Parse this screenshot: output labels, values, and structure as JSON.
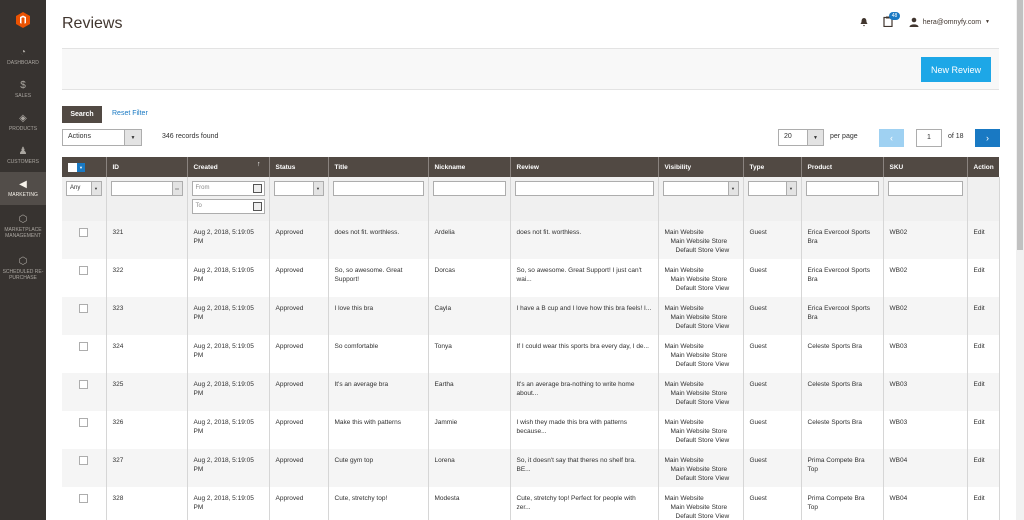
{
  "sidebar": {
    "items": [
      {
        "label": "DASHBOARD",
        "icon": "gauge-icon",
        "glyph": "◔"
      },
      {
        "label": "SALES",
        "icon": "dollar-icon",
        "glyph": "$"
      },
      {
        "label": "PRODUCTS",
        "icon": "cube-icon",
        "glyph": "◈"
      },
      {
        "label": "CUSTOMERS",
        "icon": "person-icon",
        "glyph": "♟"
      },
      {
        "label": "MARKETING",
        "icon": "megaphone-icon",
        "glyph": "◀"
      },
      {
        "label": "MARKETPLACE MANAGEMENT",
        "icon": "hexagon-icon",
        "glyph": "⬡"
      },
      {
        "label": "SCHEDULED RE-PURCHASE",
        "icon": "hexagon-icon",
        "glyph": "⬡"
      }
    ],
    "active_index": 4
  },
  "header": {
    "title": "Reviews",
    "notification_count": "48",
    "user_email": "hera@omnyfy.com"
  },
  "toolbar": {
    "new_button": "New Review",
    "search_button": "Search",
    "reset_filter": "Reset Filter",
    "actions_label": "Actions",
    "records_found": "346 records found",
    "per_page_value": "20",
    "per_page_label": "per page",
    "current_page": "1",
    "page_of": "of 18"
  },
  "columns": [
    "ID",
    "Created",
    "Status",
    "Title",
    "Nickname",
    "Review",
    "Visibility",
    "Type",
    "Product",
    "SKU",
    "Action"
  ],
  "filters": {
    "any_label": "Any",
    "from_placeholder": "From",
    "to_placeholder": "To"
  },
  "rows": [
    {
      "id": "321",
      "created": "Aug 2, 2018, 5:19:05 PM",
      "status": "Approved",
      "title": "does not fit. worthless.",
      "nickname": "Ardelia",
      "review": "does not fit. worthless.",
      "vis1": "Main Website",
      "vis2": "Main Website Store",
      "vis3": "Default Store View",
      "type": "Guest",
      "product": "Erica Evercool Sports Bra",
      "sku": "WB02",
      "action": "Edit"
    },
    {
      "id": "322",
      "created": "Aug 2, 2018, 5:19:05 PM",
      "status": "Approved",
      "title": "So, so awesome. Great Support!",
      "nickname": "Dorcas",
      "review": "So, so awesome. Great Support! I just can't wai...",
      "vis1": "Main Website",
      "vis2": "Main Website Store",
      "vis3": "Default Store View",
      "type": "Guest",
      "product": "Erica Evercool Sports Bra",
      "sku": "WB02",
      "action": "Edit"
    },
    {
      "id": "323",
      "created": "Aug 2, 2018, 5:19:05 PM",
      "status": "Approved",
      "title": "I love this bra",
      "nickname": "Cayla",
      "review": "I have a B cup and I love how this bra feels! I...",
      "vis1": "Main Website",
      "vis2": "Main Website Store",
      "vis3": "Default Store View",
      "type": "Guest",
      "product": "Erica Evercool Sports Bra",
      "sku": "WB02",
      "action": "Edit"
    },
    {
      "id": "324",
      "created": "Aug 2, 2018, 5:19:05 PM",
      "status": "Approved",
      "title": "So comfortable",
      "nickname": "Tonya",
      "review": "If I could wear this sports bra every day, I de...",
      "vis1": "Main Website",
      "vis2": "Main Website Store",
      "vis3": "Default Store View",
      "type": "Guest",
      "product": "Celeste Sports Bra",
      "sku": "WB03",
      "action": "Edit"
    },
    {
      "id": "325",
      "created": "Aug 2, 2018, 5:19:05 PM",
      "status": "Approved",
      "title": "It's an average bra",
      "nickname": "Eartha",
      "review": "It's an average bra-nothing to write home about...",
      "vis1": "Main Website",
      "vis2": "Main Website Store",
      "vis3": "Default Store View",
      "type": "Guest",
      "product": "Celeste Sports Bra",
      "sku": "WB03",
      "action": "Edit"
    },
    {
      "id": "326",
      "created": "Aug 2, 2018, 5:19:05 PM",
      "status": "Approved",
      "title": "Make this with patterns",
      "nickname": "Jammie",
      "review": "I wish they made this bra with patterns because...",
      "vis1": "Main Website",
      "vis2": "Main Website Store",
      "vis3": "Default Store View",
      "type": "Guest",
      "product": "Celeste Sports Bra",
      "sku": "WB03",
      "action": "Edit"
    },
    {
      "id": "327",
      "created": "Aug 2, 2018, 5:19:05 PM",
      "status": "Approved",
      "title": "Cute gym top",
      "nickname": "Lorena",
      "review": "So, it doesn't say that theres no shelf bra. BE...",
      "vis1": "Main Website",
      "vis2": "Main Website Store",
      "vis3": "Default Store View",
      "type": "Guest",
      "product": "Prima Compete Bra Top",
      "sku": "WB04",
      "action": "Edit"
    },
    {
      "id": "328",
      "created": "Aug 2, 2018, 5:19:05 PM",
      "status": "Approved",
      "title": "Cute, stretchy top!",
      "nickname": "Modesta",
      "review": "Cute, stretchy top! Perfect for people with zer...",
      "vis1": "Main Website",
      "vis2": "Main Website Store",
      "vis3": "Default Store View",
      "type": "Guest",
      "product": "Prima Compete Bra Top",
      "sku": "WB04",
      "action": "Edit"
    }
  ]
}
